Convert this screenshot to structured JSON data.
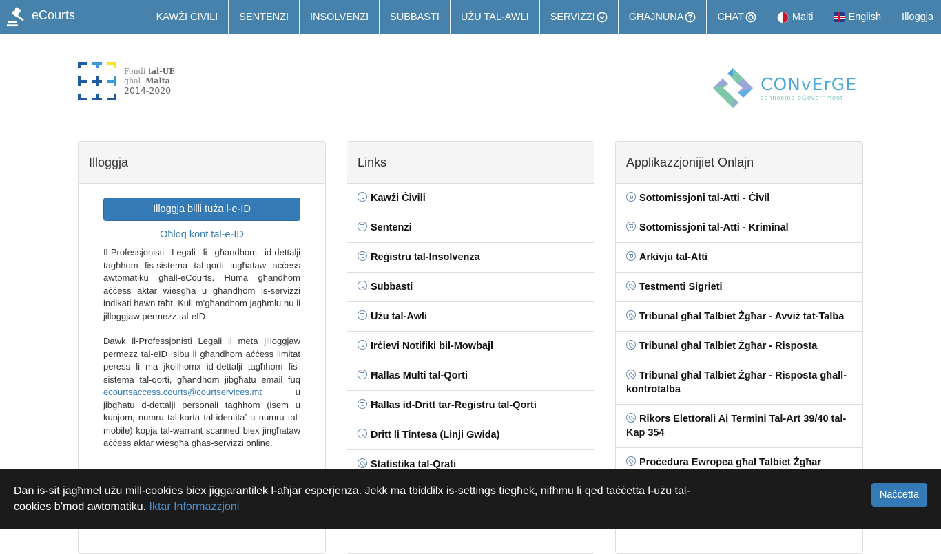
{
  "navbar": {
    "brand": "eCourts",
    "items": [
      {
        "label": "KAWŻI ĊIVILI"
      },
      {
        "label": "SENTENZI"
      },
      {
        "label": "INSOLVENZI"
      },
      {
        "label": "SUBBASTI"
      },
      {
        "label": "UŻU TAL-AWLI"
      },
      {
        "label": "SERVIZZI",
        "icon": "chevron-down-circle-icon"
      },
      {
        "label": "GĦAJNUNA",
        "icon": "question-circle-icon"
      },
      {
        "label": "CHAT",
        "icon": "chat-circle-icon"
      }
    ],
    "lang_mt": "Malti",
    "lang_en": "English",
    "login": "Illoggja"
  },
  "logos": {
    "eu": {
      "line1a": "Fondi",
      "line1b": "tal-UE",
      "line2a": "għal",
      "line2b": "Malta",
      "years": "2014-2020"
    },
    "converge": {
      "title": "CONvErGE",
      "subtitle": "connected eGovernment"
    }
  },
  "login_panel": {
    "title": "Illoggja",
    "eid_button": "Illoggja billi tuża l-e-ID",
    "open_account": "Oħloq kont tal-e-ID",
    "para1": "Il-Professjonisti Legali li għandhom id-dettalji tagħhom fis-sistema tal-qorti ingħataw aċċess awtomatiku għall-eCourts. Huma għandhom aċċess aktar wiesgħa u għandhom is-servizzi indikati hawn taħt. Kull m’għandhom jagħmlu hu li jilloggjaw permezz tal-eID.",
    "para2_before": "Dawk il-Professjonisti Legali li meta jilloggjaw permezz tal-eID isibu li għandhom aċċess limitat peress li ma jkollhomx id-dettalji tagħhom fis-sistema tal-qorti, għandhom jibgħatu email fuq ",
    "para2_email": "ecourtsaccess.courts@courtservices.mt",
    "para2_after": " u jibgħatu d-dettalji personali tagħhom (isem u kunjom, numru tal-karta tal-identita’ u numru tal-mobile) kopja tal-warrant scanned biex jingħataw aċċess aktar wiesgħa għas-servizzi online."
  },
  "links_panel": {
    "title": "Links",
    "items": [
      {
        "label": "Kawżi Ċivili",
        "icon": "filter"
      },
      {
        "label": "Sentenzi",
        "icon": "filter"
      },
      {
        "label": "Reġistru tal-Insolvenza",
        "icon": "filter"
      },
      {
        "label": "Subbasti",
        "icon": "filter"
      },
      {
        "label": "Użu tal-Awli",
        "icon": "filter"
      },
      {
        "label": "Irċievi Notifiki bil-Mowbajl",
        "icon": "filter"
      },
      {
        "label": "Ħallas Multi tal-Qorti",
        "icon": "filter"
      },
      {
        "label": "Ħallas id-Dritt tar-Reġistru tal-Qorti",
        "icon": "filter"
      },
      {
        "label": "Dritt li Tintesa (Linji Gwida)",
        "icon": "filter"
      },
      {
        "label": "Statistika tal-Qrati",
        "icon": "link"
      }
    ]
  },
  "apps_panel": {
    "title": "Applikazzjonijiet Onlajn",
    "items": [
      {
        "label": "Sottomissjoni tal-Atti - Ċivil",
        "icon": "filter"
      },
      {
        "label": "Sottomissjoni tal-Atti - Kriminal",
        "icon": "filter"
      },
      {
        "label": "Arkivju tal-Atti",
        "icon": "filter"
      },
      {
        "label": "Testmenti Sigrieti",
        "icon": "link"
      },
      {
        "label": "Tribunal għal Talbiet Żgħar - Avviż tat-Talba",
        "icon": "link"
      },
      {
        "label": "Tribunal għal Talbiet Żgħar - Risposta",
        "icon": "link"
      },
      {
        "label": "Tribunal għal Talbiet Żgħar - Risposta għall-kontrotalba",
        "icon": "link"
      },
      {
        "label": "Rikors Elettorali Ai Termini Tal-Art 39/40 tal-Kap 354",
        "icon": "link"
      },
      {
        "label": "Proċedura Ewropea għal Talbiet Żgħar",
        "icon": "link"
      }
    ]
  },
  "cookie_bar": {
    "text": "Dan is-sit jagħmel użu mill-cookies biex jiggarantilek l-aħjar esperjenza. Jekk ma tbiddilx is-settings tiegħek, nifhmu li qed taċċetta l-użu tal-cookies b’mod awtomatiku. ",
    "more_link": "Iktar Informazzjoni",
    "accept_button": "Naċċetta"
  },
  "colors": {
    "navbar": "#4682ac",
    "primary": "#337ab7",
    "cookie_bg": "#1b1b1b"
  }
}
